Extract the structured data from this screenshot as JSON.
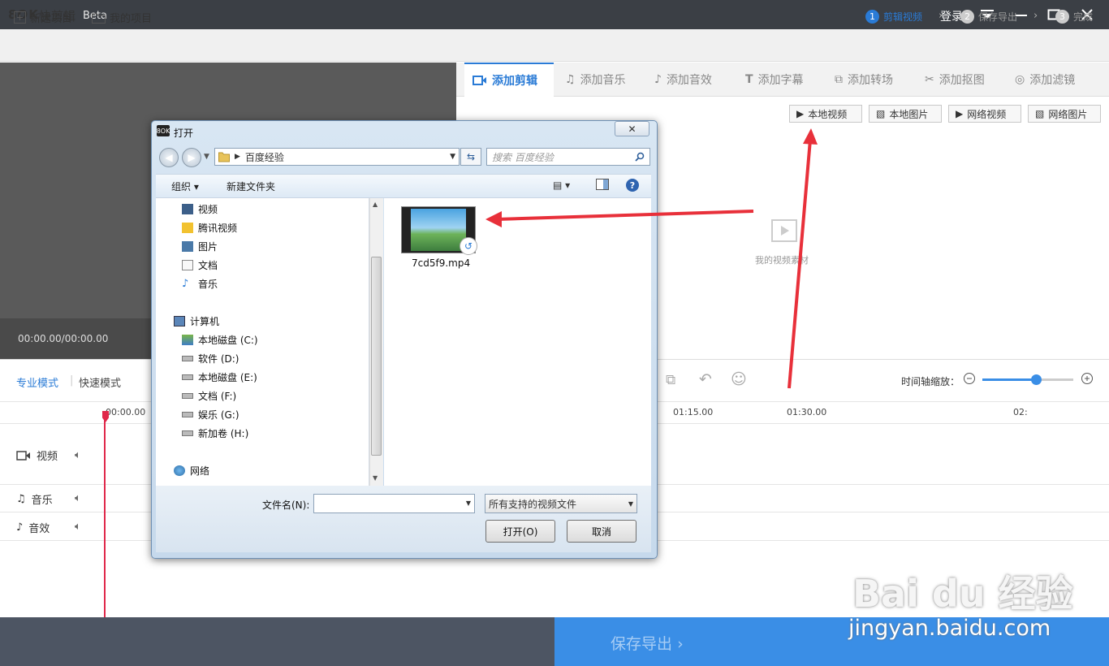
{
  "app": {
    "logo": "8OK",
    "title": "快剪辑",
    "beta": "Beta",
    "login": "登录"
  },
  "menu": {
    "new_project": "新建项目",
    "my_projects": "我的项目"
  },
  "steps": [
    {
      "num": "1",
      "label": "剪辑视频"
    },
    {
      "num": "2",
      "label": "保存导出"
    },
    {
      "num": "3",
      "label": "完成"
    }
  ],
  "preview": {
    "timecode": "00:00.00/00:00.00"
  },
  "tabs": [
    "添加剪辑",
    "添加音乐",
    "添加音效",
    "添加字幕",
    "添加转场",
    "添加抠图",
    "添加滤镜"
  ],
  "sources": [
    "本地视频",
    "本地图片",
    "网络视频",
    "网络图片"
  ],
  "material_label": "我的视频素材",
  "modes": {
    "pro": "专业模式",
    "fast": "快速模式"
  },
  "zoom_label": "时间轴缩放：",
  "ruler": [
    "00:00.00",
    "01:15.00",
    "01:30.00",
    "02:"
  ],
  "tracks": [
    "视频",
    "音乐",
    "音效"
  ],
  "footer": {
    "export": "保存导出"
  },
  "watermark": {
    "logo": "Bai du 经验",
    "url": "jingyan.baidu.com"
  },
  "dialog": {
    "title": "打开",
    "icon": "8OK",
    "address": "百度经验",
    "search_placeholder": "搜索 百度经验",
    "organize": "组织 ▾",
    "new_folder": "新建文件夹",
    "nav_libraries": [
      {
        "label": "视频",
        "icon": "video-library-icon"
      },
      {
        "label": "腾讯视频",
        "icon": "folder-icon"
      },
      {
        "label": "图片",
        "icon": "picture-library-icon"
      },
      {
        "label": "文档",
        "icon": "document-library-icon"
      },
      {
        "label": "音乐",
        "icon": "music-library-icon"
      }
    ],
    "computer": "计算机",
    "drives": [
      "本地磁盘 (C:)",
      "软件 (D:)",
      "本地磁盘 (E:)",
      "文档 (F:)",
      "娱乐 (G:)",
      "新加卷 (H:)"
    ],
    "network": "网络",
    "file": "7cd5f9.mp4",
    "filename_label": "文件名(N):",
    "filter": "所有支持的视频文件",
    "open": "打开(O)",
    "cancel": "取消"
  },
  "colors": {
    "accent": "#2a7bd6",
    "titlebar": "#3b3f45",
    "export": "#3a8ee6",
    "arrow": "#e8303a"
  }
}
